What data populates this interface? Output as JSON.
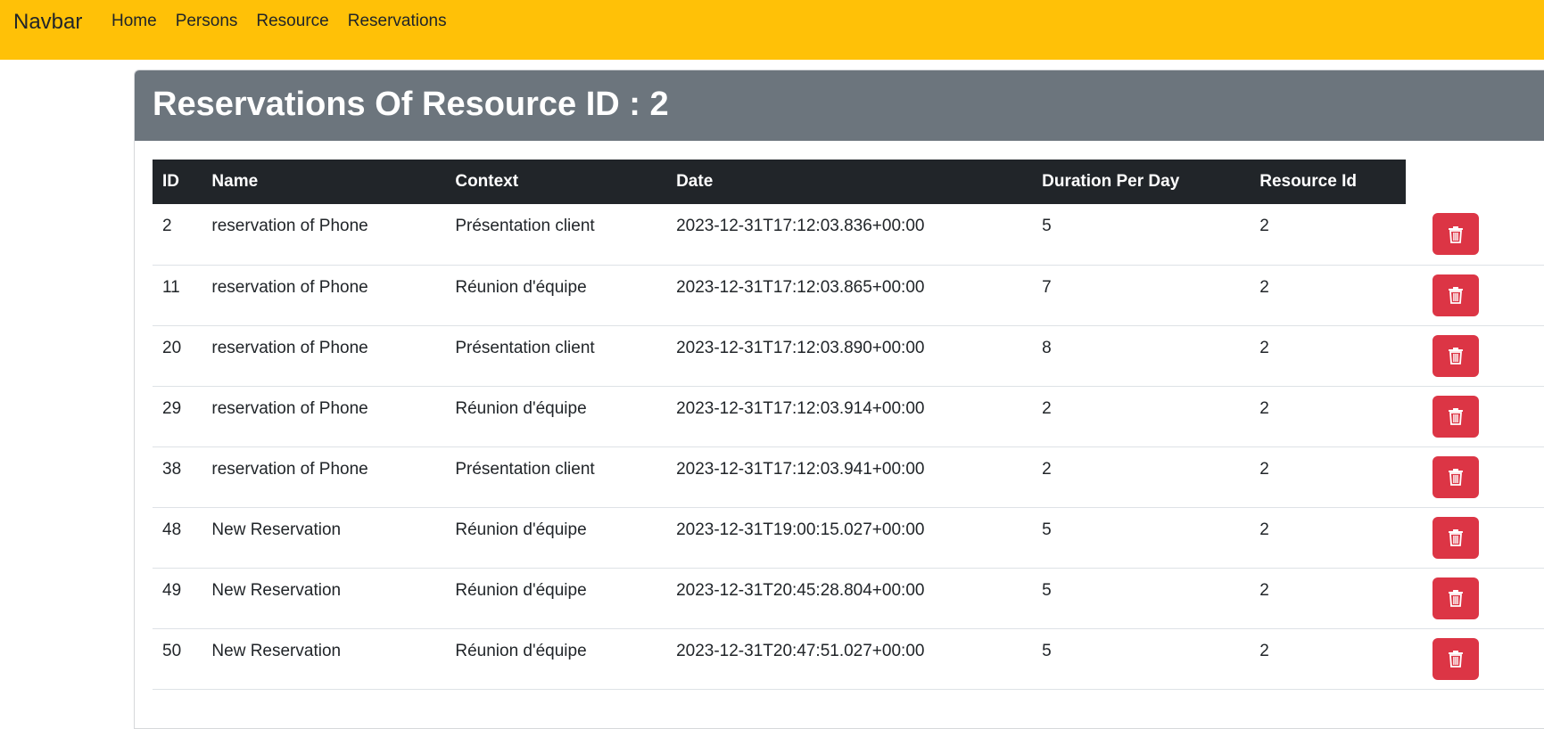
{
  "navbar": {
    "brand": "Navbar",
    "links": [
      "Home",
      "Persons",
      "Resource",
      "Reservations"
    ],
    "color": "#ffc107"
  },
  "card": {
    "title": "Reservations Of Resource ID : 2",
    "header_color": "#6c757d"
  },
  "table": {
    "headers": [
      "ID",
      "Name",
      "Context",
      "Date",
      "Duration Per Day",
      "Resource Id"
    ],
    "rows": [
      {
        "id": "2",
        "name": "reservation of Phone",
        "context": "Présentation client",
        "date": "2023-12-31T17:12:03.836+00:00",
        "duration": "5",
        "resource_id": "2"
      },
      {
        "id": "11",
        "name": "reservation of Phone",
        "context": "Réunion d'équipe",
        "date": "2023-12-31T17:12:03.865+00:00",
        "duration": "7",
        "resource_id": "2"
      },
      {
        "id": "20",
        "name": "reservation of Phone",
        "context": "Présentation client",
        "date": "2023-12-31T17:12:03.890+00:00",
        "duration": "8",
        "resource_id": "2"
      },
      {
        "id": "29",
        "name": "reservation of Phone",
        "context": "Réunion d'équipe",
        "date": "2023-12-31T17:12:03.914+00:00",
        "duration": "2",
        "resource_id": "2"
      },
      {
        "id": "38",
        "name": "reservation of Phone",
        "context": "Présentation client",
        "date": "2023-12-31T17:12:03.941+00:00",
        "duration": "2",
        "resource_id": "2"
      },
      {
        "id": "48",
        "name": "New Reservation",
        "context": "Réunion d'équipe",
        "date": "2023-12-31T19:00:15.027+00:00",
        "duration": "5",
        "resource_id": "2"
      },
      {
        "id": "49",
        "name": "New Reservation",
        "context": "Réunion d'équipe",
        "date": "2023-12-31T20:45:28.804+00:00",
        "duration": "5",
        "resource_id": "2"
      },
      {
        "id": "50",
        "name": "New Reservation",
        "context": "Réunion d'équipe",
        "date": "2023-12-31T20:47:51.027+00:00",
        "duration": "5",
        "resource_id": "2"
      }
    ],
    "delete_icon": "trash-icon",
    "delete_color": "#dc3545"
  }
}
